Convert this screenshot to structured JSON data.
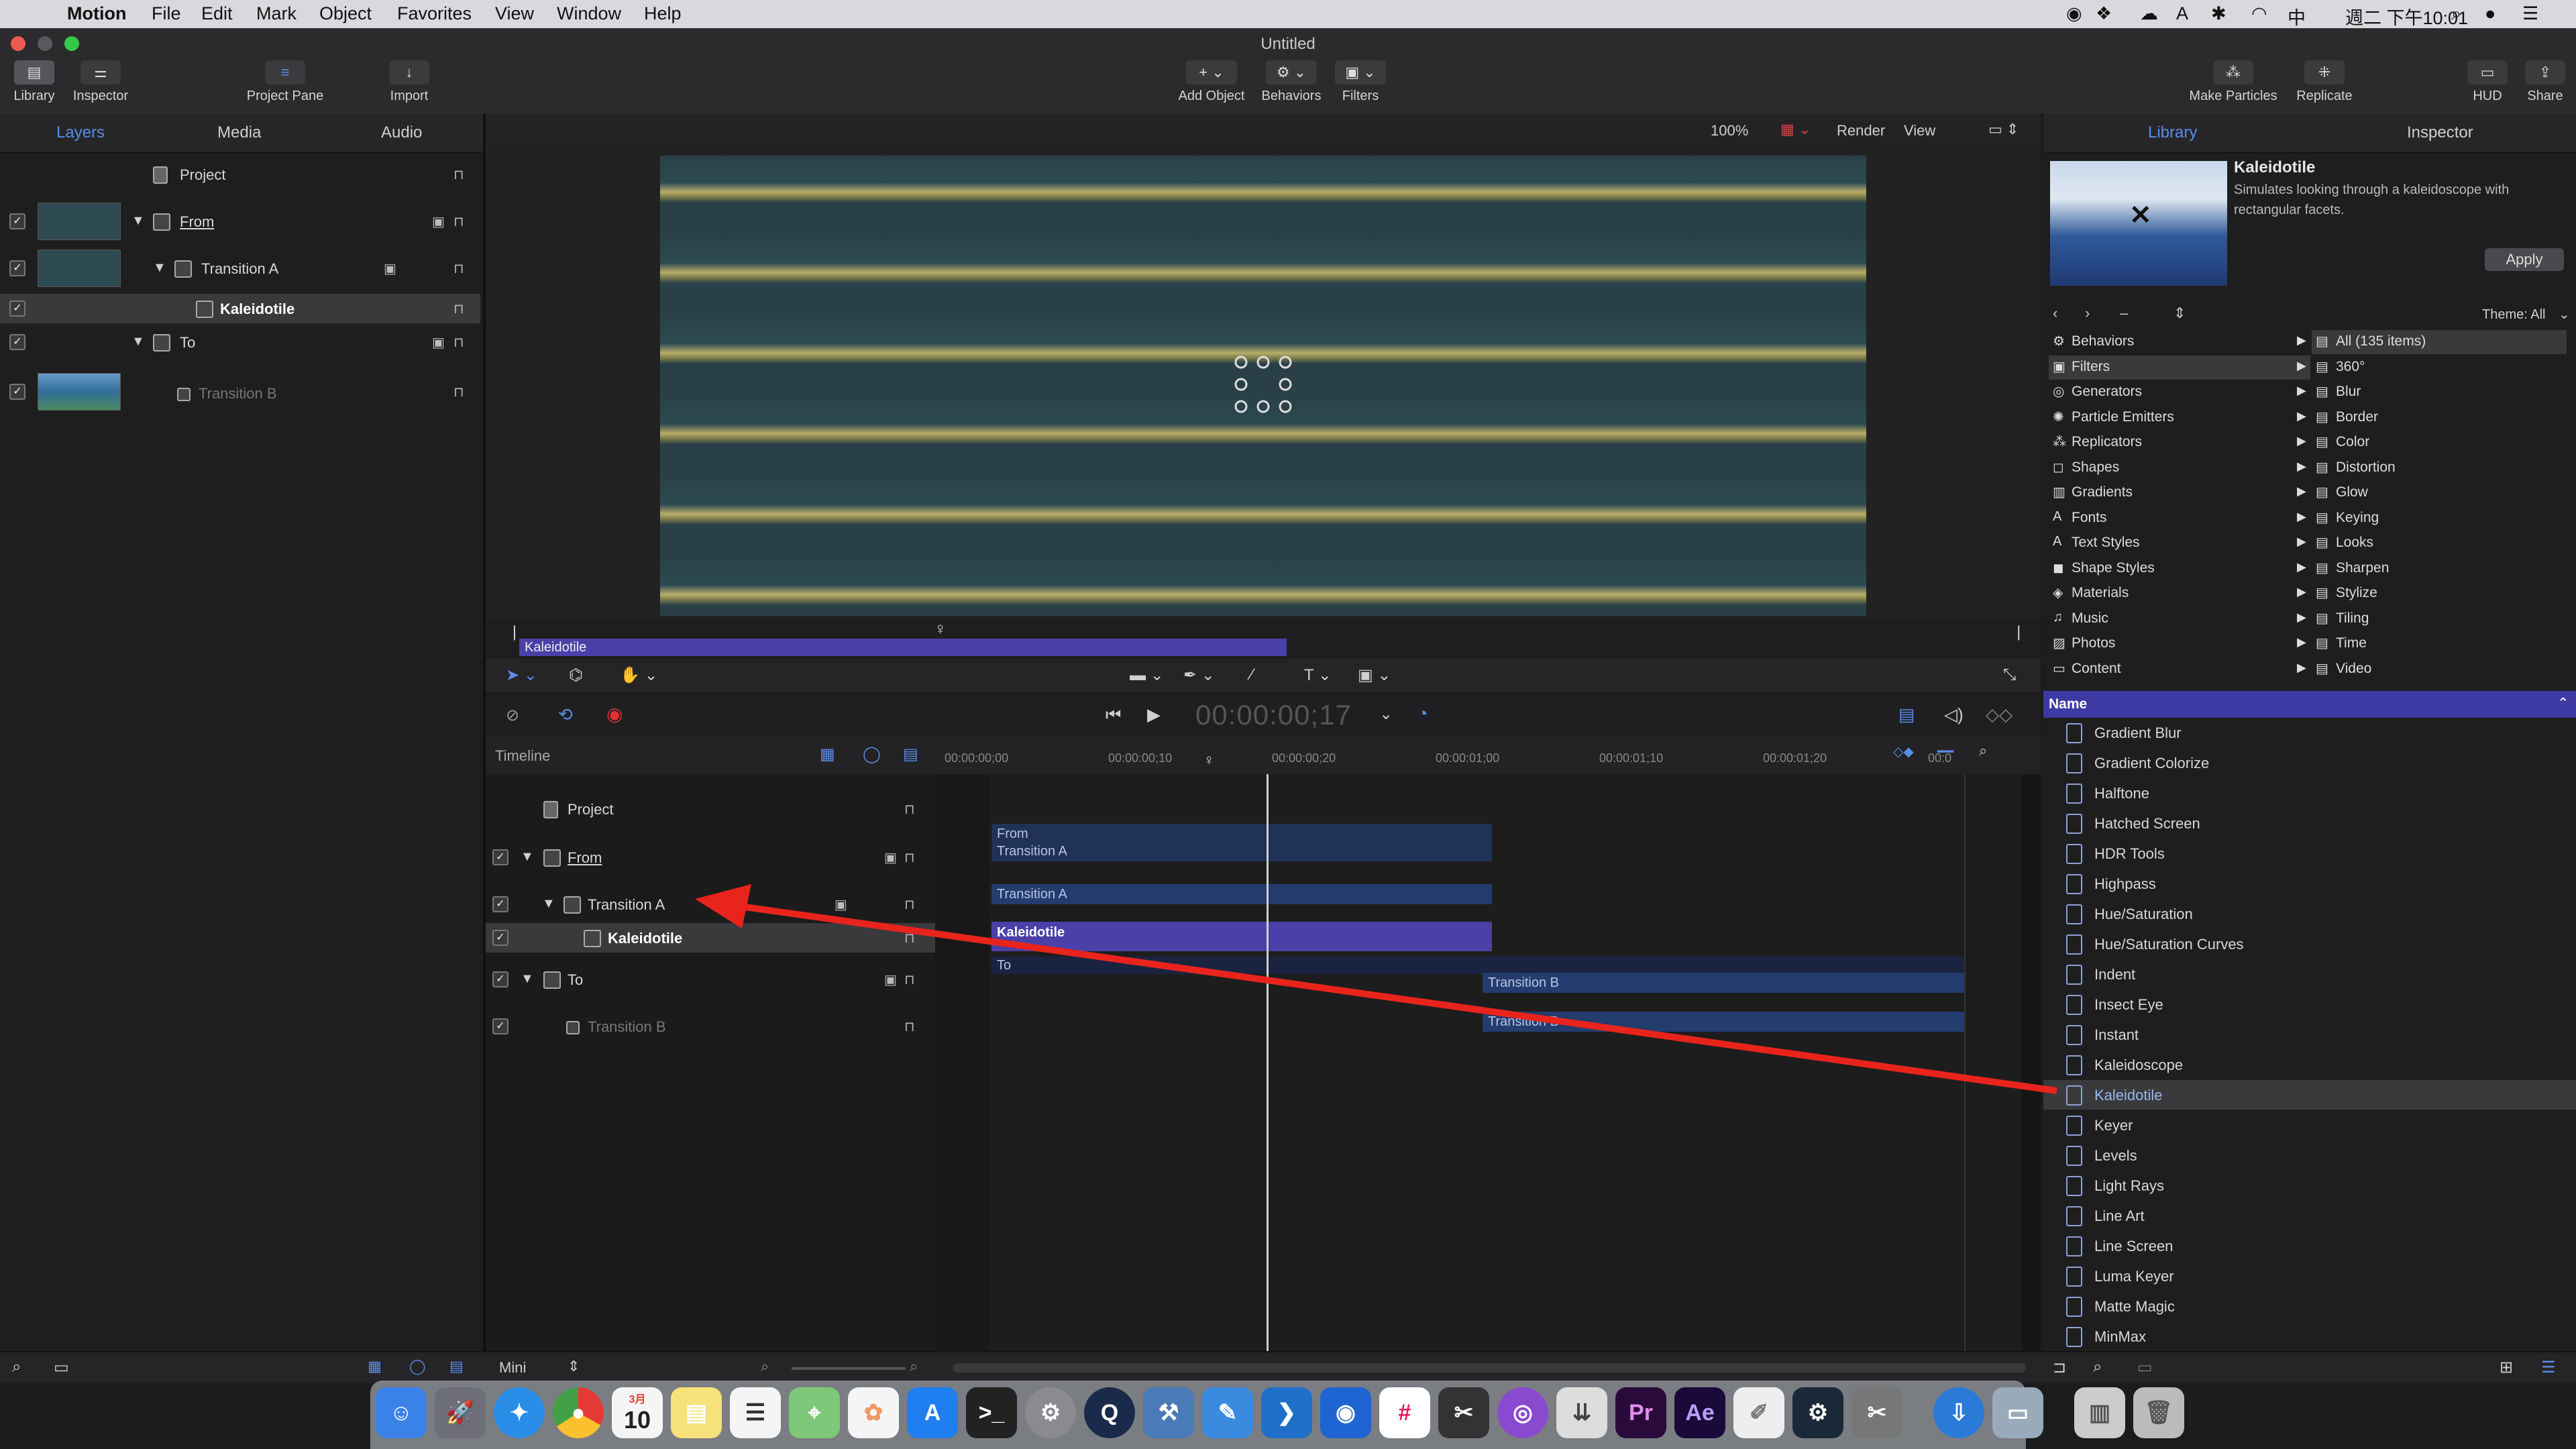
{
  "menubar": {
    "app": "Motion",
    "items": [
      "File",
      "Edit",
      "Mark",
      "Object",
      "Favorites",
      "View",
      "Window",
      "Help"
    ],
    "clock": "週二 下午10:01"
  },
  "window": {
    "title": "Untitled",
    "left_buttons": [
      {
        "label": "Library",
        "icon": "library-icon"
      },
      {
        "label": "Inspector",
        "icon": "inspector-icon"
      },
      {
        "label": "Project Pane",
        "icon": "project-pane-icon"
      },
      {
        "label": "Import",
        "icon": "import-icon"
      }
    ],
    "center_buttons": [
      {
        "label": "Add Object",
        "icon": "plus-icon"
      },
      {
        "label": "Behaviors",
        "icon": "gear-icon"
      },
      {
        "label": "Filters",
        "icon": "filters-icon"
      }
    ],
    "right_buttons": [
      {
        "label": "Make Particles",
        "icon": "particles-icon"
      },
      {
        "label": "Replicate",
        "icon": "replicate-icon"
      },
      {
        "label": "HUD",
        "icon": "hud-icon"
      },
      {
        "label": "Share",
        "icon": "share-icon"
      }
    ]
  },
  "layers_panel": {
    "tabs": [
      "Layers",
      "Media",
      "Audio"
    ],
    "active_tab": "Layers",
    "rows": [
      {
        "name": "Project"
      },
      {
        "name": "From"
      },
      {
        "name": "Transition A"
      },
      {
        "name": "Kaleidotile"
      },
      {
        "name": "To"
      },
      {
        "name": "Transition B"
      }
    ]
  },
  "canvas": {
    "zoom": "100%",
    "render_menu": "Render",
    "view_menu": "View",
    "mini_timeline_clip": "Kaleidotile"
  },
  "transport": {
    "timecode": "00:00:00;17"
  },
  "timeline": {
    "title": "Timeline",
    "ruler": [
      "00:00:00;00",
      "00:00:00;10",
      "00:00:00;20",
      "00:00:01;00",
      "00:00:01;10",
      "00:00:01;20",
      "00:0"
    ],
    "layers": [
      {
        "name": "Project"
      },
      {
        "name": "From"
      },
      {
        "name": "Transition A"
      },
      {
        "name": "Kaleidotile"
      },
      {
        "name": "To"
      },
      {
        "name": "Transition B"
      }
    ],
    "clips": [
      "From",
      "Transition A",
      "Transition A",
      "Kaleidotile",
      "To",
      "Transition B",
      "Transition B"
    ],
    "mini_label": "Mini"
  },
  "library": {
    "tabs": [
      "Library",
      "Inspector"
    ],
    "active_tab": "Library",
    "preview": {
      "title": "Kaleidotile",
      "description": "Simulates looking through a kaleidoscope with rectangular facets.",
      "apply_label": "Apply"
    },
    "theme_label": "Theme: All",
    "categories": [
      "Behaviors",
      "Filters",
      "Generators",
      "Particle Emitters",
      "Replicators",
      "Shapes",
      "Gradients",
      "Fonts",
      "Text Styles",
      "Shape Styles",
      "Materials",
      "Music",
      "Photos",
      "Content"
    ],
    "selected_category": "Filters",
    "subcategories": [
      "All (135 items)",
      "360°",
      "Blur",
      "Border",
      "Color",
      "Distortion",
      "Glow",
      "Keying",
      "Looks",
      "Sharpen",
      "Stylize",
      "Tiling",
      "Time",
      "Video"
    ],
    "list_header": "Name",
    "items": [
      "Gradient Blur",
      "Gradient Colorize",
      "Halftone",
      "Hatched Screen",
      "HDR Tools",
      "Highpass",
      "Hue/Saturation",
      "Hue/Saturation Curves",
      "Indent",
      "Insect Eye",
      "Instant",
      "Kaleidoscope",
      "Kaleidotile",
      "Keyer",
      "Levels",
      "Light Rays",
      "Line Art",
      "Line Screen",
      "Luma Keyer",
      "Matte Magic",
      "MinMax"
    ],
    "selected_item": "Kaleidotile"
  },
  "dock": {
    "calendar_month": "3月",
    "calendar_day": "10",
    "premiere_label": "Pr",
    "after_effects_label": "Ae"
  },
  "colors": {
    "accent": "#5a8de8",
    "clip_blue": "#243c6e",
    "clip_selected": "#4a40a8",
    "arrow": "#e8241c"
  }
}
